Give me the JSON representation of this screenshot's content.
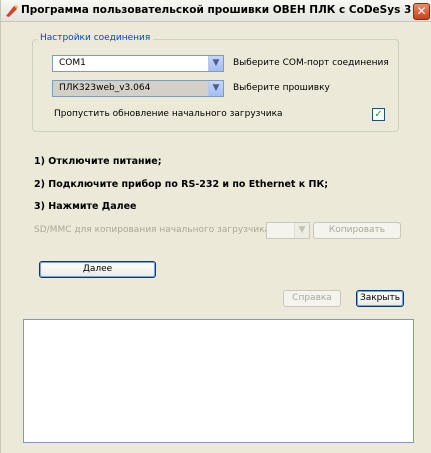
{
  "window": {
    "title": "Программа пользовательской прошивки ОВЕН ПЛК с CoDeSys 3",
    "close_glyph": "✕"
  },
  "connection": {
    "group_label": "Настройки соединения",
    "com_port_value": "COM1",
    "com_port_label": "Выберите COM-порт соединения",
    "firmware_value": "ПЛК323web_v3.064",
    "firmware_label": "Выберите прошивку",
    "skip_bootloader_label": "Пропустить обновление начального загрузчика",
    "skip_bootloader_checked": true,
    "check_glyph": "✓"
  },
  "steps": [
    "1) Отключите питание;",
    "2) Подключите прибор по RS-232 и по Ethernet к ПК;",
    "3) Нажмите Далее"
  ],
  "sdmmc": {
    "label": "SD/MMC для копирования начального загрузчика",
    "value": "",
    "copy_label": "Копировать"
  },
  "buttons": {
    "next": "Далее",
    "help": "Справка",
    "close": "Закрыть"
  },
  "icons": {
    "app": "app-icon",
    "dropdown": "chevron-down-icon",
    "close": "close-icon"
  },
  "colors": {
    "title_bg": "#f1f0eb",
    "close_button": "#c9421c",
    "group_label": "#0046d5",
    "window_bg": "#ece9d8",
    "check": "#21a121"
  }
}
